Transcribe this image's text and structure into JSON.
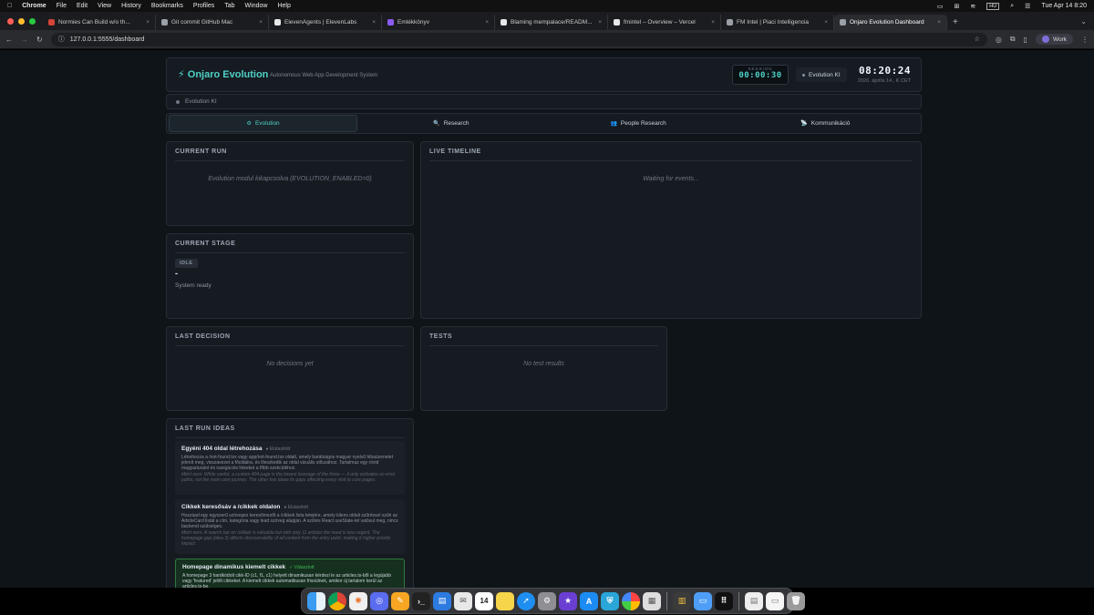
{
  "menubar": {
    "app": "Chrome",
    "items": [
      "File",
      "Edit",
      "View",
      "History",
      "Bookmarks",
      "Profiles",
      "Tab",
      "Window",
      "Help"
    ],
    "clock": "Tue Apr 14  8:20",
    "lang": "HU"
  },
  "tabs": [
    {
      "label": "Normies Can Build w/o th...",
      "color": "#d44638"
    },
    {
      "label": "Git commit GitHub Mac",
      "color": "#9aa0a6"
    },
    {
      "label": "ElevenAgents | ElevenLabs",
      "color": "#e8e8e8"
    },
    {
      "label": "Emlékkönyv",
      "color": "#8b5cf6"
    },
    {
      "label": "Blaming mempalace/READM...",
      "color": "#e8e8e8"
    },
    {
      "label": "fmintel – Overview – Vercel",
      "color": "#e8e8e8"
    },
    {
      "label": "FM Intel | Piaci Intelligencia",
      "color": "#9aa0a6"
    },
    {
      "label": "Onjaro Evolution Dashboard",
      "color": "#9aa0a6",
      "active": true
    }
  ],
  "url": "127.0.0.1:5555/dashboard",
  "profile_label": "Work",
  "header": {
    "logo": "Onjaro Evolution",
    "subtitle": "Autonomous Web App Development System",
    "session_label": "SESSION",
    "session_time": "00:00:30",
    "evolution_badge": "Evolution KI",
    "clock_time": "08:20:24",
    "clock_date": "2026. április 14., K CET"
  },
  "status_label": "Evolution KI",
  "nav_tabs": [
    {
      "icon": "⚙",
      "label": "Evolution",
      "active": true
    },
    {
      "icon": "🔍",
      "label": "Research"
    },
    {
      "icon": "👥",
      "label": "People Research"
    },
    {
      "icon": "📡",
      "label": "Kommunikáció"
    }
  ],
  "panels": {
    "current_run": {
      "title": "CURRENT RUN",
      "message": "Evolution modul kikapcsolva (EVOLUTION_ENABLED=0)"
    },
    "live_timeline": {
      "title": "LIVE TIMELINE",
      "message": "Waiting for events..."
    },
    "current_stage": {
      "title": "CURRENT STAGE",
      "badge": "IDLE",
      "stage": "-",
      "status": "System ready"
    },
    "last_decision": {
      "title": "LAST DECISION",
      "message": "No decisions yet"
    },
    "tests": {
      "title": "TESTS",
      "message": "No test results"
    },
    "last_run_ideas": {
      "title": "LAST RUN IDEAS",
      "ideas": [
        {
          "title": "Egyéni 404 oldal létrehozása",
          "tag": "● Elutasított",
          "desc": "Létrehozza a /not-found.tsx vagy app/not-found.tsx oldalt, amely barátságos magyar nyelvű hibaüzenetet jelenít meg, visszavezet a főoldalra, és illeszkedik az oldal vizuális stílusához. Tartalmaz egy rövid magyarázatot és navigációs linkeket a főbb szekciókhoz.",
          "note": "Miért nem: While useful, a custom 404 page is the lowest leverage of the three — it only activates on error paths, not the main user journey. The other two ideas fix gaps affecting every visit to core pages."
        },
        {
          "title": "Cikkek keresősáv a /cikkek oldalon",
          "tag": "● Elutasított",
          "desc": "Hozzáad egy egyszerű szöveges keresőmezőt a /cikkek lista tetejére, amely kliens oldali szűréssel szűri az ArticleCard listát a cím, kategória vagy lead szöveg alapján. A szűrés React useState-tel valósul meg, nincs backend szükséges.",
          "note": "Miért nem: A search bar on /cikkek is valuable but with only 11 articles the need is less urgent. The homepage gap (idea 3) affects discoverability of all content from the entry point, making it higher priority impact."
        },
        {
          "title": "Homepage dinamikus kiemelt cikkek",
          "tag": "✓ Választott",
          "desc": "A homepage 3 hardkódolt cikk-ID (c1, f1, c1) helyett dinamikusan kérdezi le az articles.ts-ből a legújabb vagy 'featured' jelölt cikkeket. A kiemelt cikkek automatikusan frissülnek, amikor új tartalom kerül az articles.ts-be.",
          "note": ""
        }
      ]
    }
  }
}
